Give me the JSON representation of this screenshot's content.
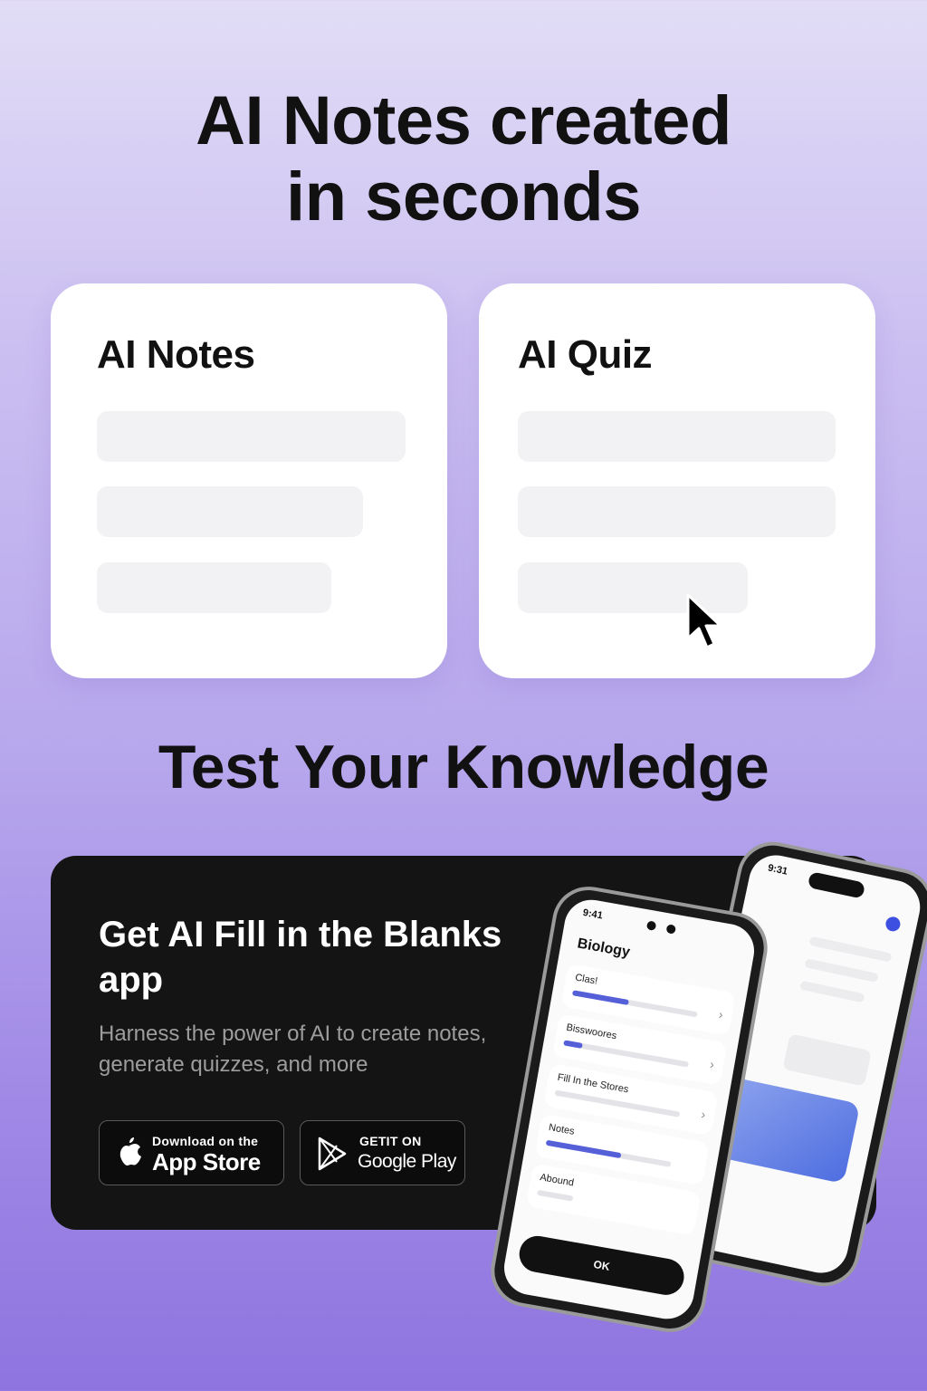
{
  "headline": {
    "line1": "AI Notes created",
    "line2": "in seconds"
  },
  "cards": {
    "notes": {
      "title": "AI Notes"
    },
    "quiz": {
      "title": "AI Quiz"
    }
  },
  "subheadline": "Test Your Knowledge",
  "promo": {
    "title": "Get AI Fill in the Blanks app",
    "description": "Harness the power of AI to create notes, generate quizzes, and more",
    "app_store": {
      "small": "Download on the",
      "big": "App Store"
    },
    "google_play": {
      "small": "GETIT ON",
      "big": "Google Play"
    }
  },
  "phone_front": {
    "time": "9:41",
    "title": "Biology",
    "rows": [
      {
        "label": "Clas!",
        "progress": 0.45
      },
      {
        "label": "Bisswoores",
        "progress": 0.15
      },
      {
        "label": "Fill In the Stores",
        "progress": 0
      },
      {
        "label": "Notes",
        "progress": 0.6
      },
      {
        "label": "Abound",
        "progress": 0
      }
    ],
    "button": "OK"
  },
  "phone_back": {
    "time": "9:31"
  },
  "colors": {
    "accent": "#5560d8",
    "promo_bg": "#141414",
    "card_bar": "#f2f2f4"
  }
}
